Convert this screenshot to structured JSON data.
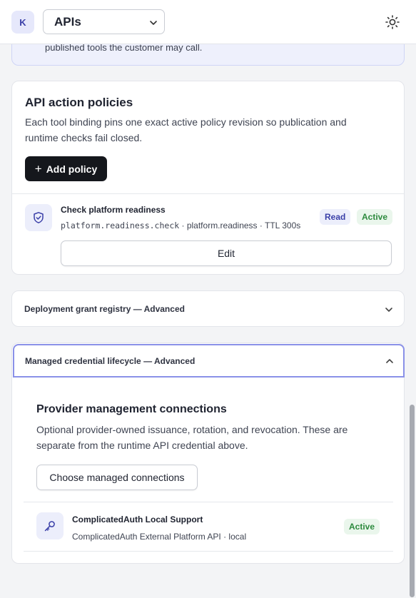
{
  "header": {
    "avatar_initial": "K",
    "section_select": "APIs",
    "theme_toggle_icon": "sun-icon"
  },
  "notice": {
    "text": "published tools the customer may call."
  },
  "policies": {
    "title": "API action policies",
    "description": "Each tool binding pins one exact active policy revision so publication and runtime checks fail closed.",
    "add_button": "Add policy",
    "items": [
      {
        "icon": "shield-check-icon",
        "name": "Check platform readiness",
        "code": "platform.readiness.check",
        "meta": " · platform.readiness · TTL 300s",
        "access_badge": "Read",
        "status_badge": "Active",
        "edit_label": "Edit"
      }
    ]
  },
  "grant_registry": {
    "title": "Deployment grant registry — Advanced",
    "expanded": false
  },
  "managed_credentials": {
    "title": "Managed credential lifecycle — Advanced",
    "expanded": true,
    "section_title": "Provider management connections",
    "description": "Optional provider-owned issuance, rotation, and revocation. These are separate from the runtime API credential above.",
    "choose_button": "Choose managed connections",
    "connections": [
      {
        "icon": "key-icon",
        "name": "ComplicatedAuth Local Support",
        "meta": "ComplicatedAuth External Platform API · local",
        "status": "Active"
      }
    ]
  },
  "colors": {
    "accent": "#3a3fa8",
    "active_green": "#2d8a3e",
    "focus_border": "#8a91e8"
  }
}
